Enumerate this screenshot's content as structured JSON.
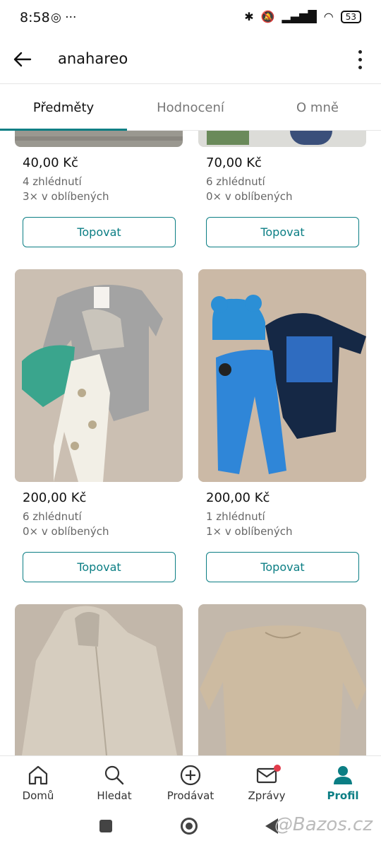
{
  "status": {
    "time": "8:58",
    "left_icons": "◎ ···",
    "battery": "53"
  },
  "appbar": {
    "title": "anahareo"
  },
  "tabs": [
    {
      "label": "Předměty"
    },
    {
      "label": "Hodnocení"
    },
    {
      "label": "O mně"
    }
  ],
  "items": [
    {
      "price": "40,00 Kč",
      "views": "4 zhlédnutí",
      "favs": "3× v oblíbených",
      "button": "Topovat"
    },
    {
      "price": "70,00 Kč",
      "views": "6 zhlédnutí",
      "favs": "0× v oblíbených",
      "button": "Topovat"
    },
    {
      "price": "200,00 Kč",
      "views": "6 zhlédnutí",
      "favs": "0× v oblíbených",
      "button": "Topovat"
    },
    {
      "price": "200,00 Kč",
      "views": "1 zhlédnutí",
      "favs": "1× v oblíbených",
      "button": "Topovat"
    },
    {
      "price": "",
      "views": "",
      "favs": "",
      "button": ""
    },
    {
      "price": "",
      "views": "",
      "favs": "",
      "button": ""
    }
  ],
  "bottom_nav": [
    {
      "label": "Domů",
      "icon": "home-icon"
    },
    {
      "label": "Hledat",
      "icon": "search-icon"
    },
    {
      "label": "Prodávat",
      "icon": "plus-circle-icon"
    },
    {
      "label": "Zprávy",
      "icon": "mail-icon"
    },
    {
      "label": "Profil",
      "icon": "person-icon"
    }
  ],
  "watermark": "@Bazos.cz",
  "colors": {
    "accent": "#0b7e84",
    "badge": "#e23b4b"
  }
}
